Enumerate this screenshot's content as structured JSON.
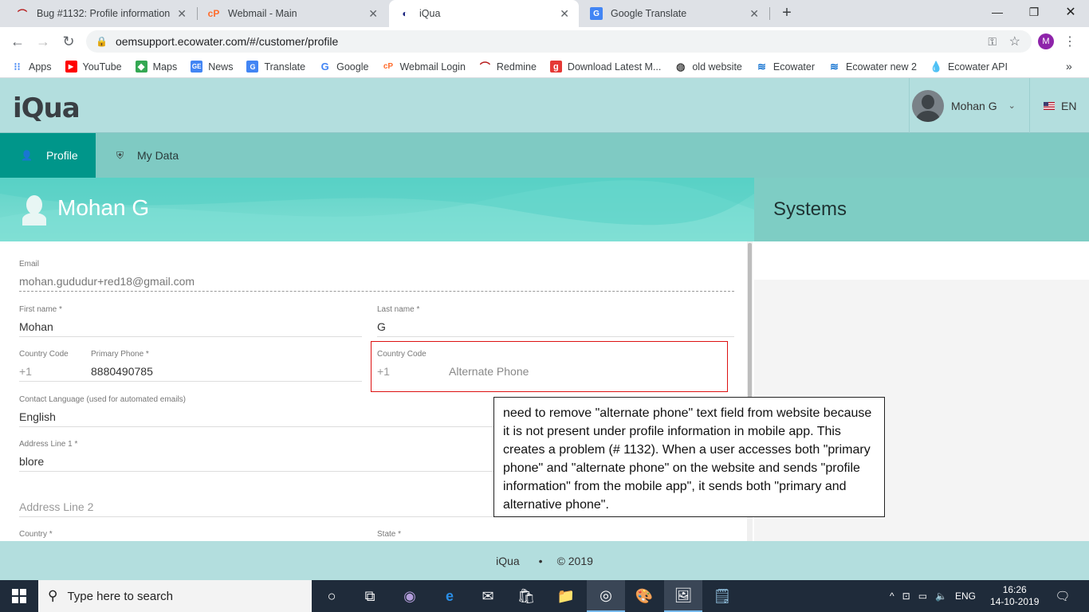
{
  "browser": {
    "tabs": [
      {
        "title": "Bug #1132: Profile information e",
        "icon": "redmine-icon",
        "active": false
      },
      {
        "title": "Webmail - Main",
        "icon": "cpanel-icon",
        "active": false
      },
      {
        "title": "iQua",
        "icon": "iqua-icon",
        "active": true
      },
      {
        "title": "Google Translate",
        "icon": "translate-icon",
        "active": false
      }
    ],
    "new_tab": "+",
    "url": "oemsupport.ecowater.com/#/customer/profile",
    "profile_initial": "M",
    "bookmarks": [
      {
        "label": "Apps",
        "icon": "apps-grid-icon"
      },
      {
        "label": "YouTube",
        "icon": "youtube-icon"
      },
      {
        "label": "Maps",
        "icon": "maps-icon"
      },
      {
        "label": "News",
        "icon": "news-icon"
      },
      {
        "label": "Translate",
        "icon": "translate-icon"
      },
      {
        "label": "Google",
        "icon": "google-icon"
      },
      {
        "label": "Webmail Login",
        "icon": "cpanel-icon"
      },
      {
        "label": "Redmine",
        "icon": "redmine-icon"
      },
      {
        "label": "Download Latest M...",
        "icon": "download-icon"
      },
      {
        "label": "old website",
        "icon": "globe-icon"
      },
      {
        "label": "Ecowater",
        "icon": "ecowater-icon"
      },
      {
        "label": "Ecowater new 2",
        "icon": "ecowater-icon"
      },
      {
        "label": "Ecowater API",
        "icon": "drop-icon"
      }
    ],
    "more_bookmarks": "»"
  },
  "app": {
    "logo": "iQua",
    "user_name": "Mohan G",
    "language": "EN",
    "nav": {
      "profile": "Profile",
      "my_data": "My Data"
    },
    "hero_name": "Mohan G",
    "systems_title": "Systems"
  },
  "form": {
    "email": {
      "label": "Email",
      "value": "mohan.gududur+red18@gmail.com"
    },
    "first_name": {
      "label": "First name *",
      "value": "Mohan"
    },
    "last_name": {
      "label": "Last name *",
      "value": "G"
    },
    "country_code": {
      "label": "Country Code",
      "value": "+1"
    },
    "primary_phone": {
      "label": "Primary Phone *",
      "value": "8880490785"
    },
    "alt_country_code": {
      "label": "Country Code",
      "value": "+1"
    },
    "alternate_phone": {
      "placeholder": "Alternate Phone"
    },
    "contact_language": {
      "label": "Contact Language (used for automated emails)",
      "value": "English"
    },
    "address1": {
      "label": "Address Line 1 *",
      "value": "blore"
    },
    "address2": {
      "placeholder": "Address Line 2"
    },
    "country": {
      "label": "Country *"
    },
    "state": {
      "label": "State *"
    }
  },
  "annotation": {
    "note": "need to remove \"alternate phone\" text field from website because it is not present under profile information in mobile app. This creates a problem (# 1132). When a user accesses both \"primary phone\" and \"alternate phone\" on the website and sends \"profile information\" from the mobile app\", it sends both \"primary and alternative phone\".",
    "highlight_color": "#dd1111"
  },
  "footer": {
    "brand": "iQua",
    "bullet": "•",
    "copyright": "© 2019"
  },
  "taskbar": {
    "search_placeholder": "Type here to search",
    "lang": "ENG",
    "time": "16:26",
    "date": "14-10-2019"
  },
  "colors": {
    "accent": "#00968a",
    "header_bg": "#b3dede",
    "nav_bg": "#7fcac3"
  }
}
